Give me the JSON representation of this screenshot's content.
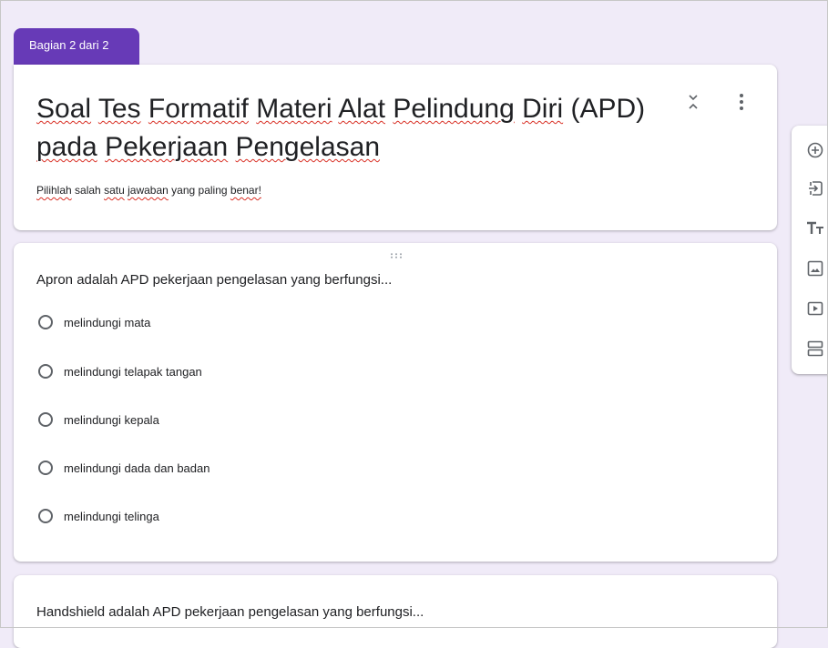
{
  "section": {
    "label": "Bagian 2 dari 2"
  },
  "form": {
    "title": "Soal Tes Formatif Materi Alat Pelindung Diri (APD) pada Pekerjaan Pengelasan",
    "title_words": [
      "Soal",
      "Tes",
      "Formatif",
      "Materi",
      "Alat",
      "Pelindung",
      "Diri",
      "(APD)",
      "pada",
      "Pekerjaan",
      "Pengelasan"
    ],
    "description_words": [
      "Pilihlah",
      "salah",
      "satu",
      "jawaban",
      "yang",
      "paling",
      "benar!"
    ]
  },
  "questions": [
    {
      "text": "Apron adalah APD pekerjaan pengelasan yang berfungsi...",
      "options": [
        "melindungi mata",
        "melindungi telapak tangan",
        "melindungi kepala",
        "melindungi dada dan badan",
        "melindungi telinga"
      ]
    },
    {
      "text": "Handshield adalah APD pekerjaan pengelasan yang berfungsi..."
    }
  ],
  "toolbar": {
    "icons": [
      "add-question-icon",
      "import-questions-icon",
      "add-title-icon",
      "add-image-icon",
      "add-video-icon",
      "add-section-icon"
    ]
  },
  "colors": {
    "accent": "#673ab7",
    "background": "#f0ebf8",
    "spellcheck": "#d93025",
    "icon": "#5f6368"
  }
}
